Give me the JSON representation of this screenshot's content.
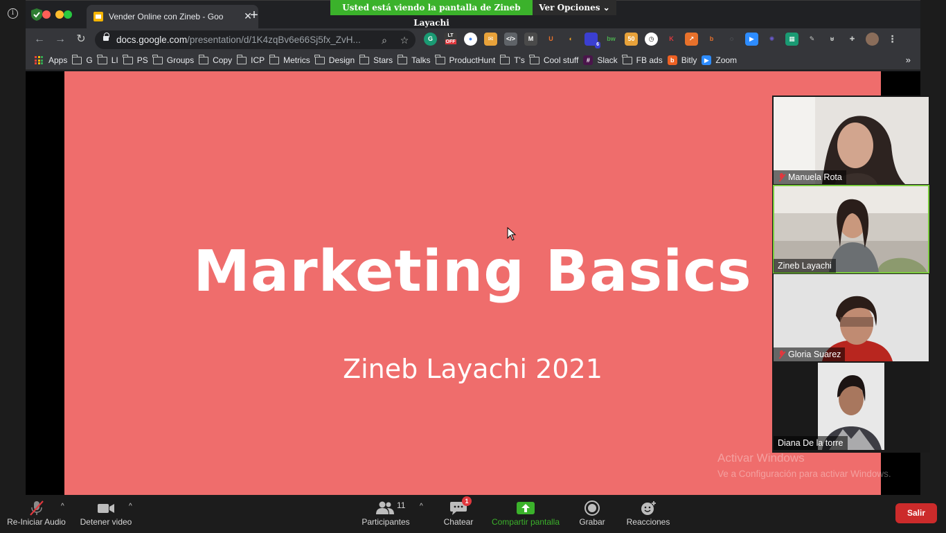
{
  "browser": {
    "tab_title": "Vender Online con Zineb - Goo",
    "url_host": "docs.google.com",
    "url_path": "/presentation/d/1K4zqBv6e66Sj5fx_ZvH...",
    "bookmarks": [
      {
        "label": "Apps",
        "icon": "apps-grid-icon"
      },
      {
        "label": "G",
        "icon": "folder-icon"
      },
      {
        "label": "LI",
        "icon": "folder-icon"
      },
      {
        "label": "PS",
        "icon": "folder-icon"
      },
      {
        "label": "Groups",
        "icon": "folder-icon"
      },
      {
        "label": "Copy",
        "icon": "folder-icon"
      },
      {
        "label": "ICP",
        "icon": "folder-icon"
      },
      {
        "label": "Metrics",
        "icon": "folder-icon"
      },
      {
        "label": "Design",
        "icon": "folder-icon"
      },
      {
        "label": "Stars",
        "icon": "folder-icon"
      },
      {
        "label": "Talks",
        "icon": "folder-icon"
      },
      {
        "label": "ProductHunt",
        "icon": "folder-icon"
      },
      {
        "label": "T's",
        "icon": "folder-icon"
      },
      {
        "label": "Cool stuff",
        "icon": "folder-icon"
      },
      {
        "label": "Slack",
        "icon": "slack-icon"
      },
      {
        "label": "FB ads",
        "icon": "folder-icon"
      },
      {
        "label": "Bitly",
        "icon": "bitly-icon"
      },
      {
        "label": "Zoom",
        "icon": "zoom-icon"
      }
    ],
    "more_bookmarks": "»",
    "extension_badges": {
      "lt": "OFF",
      "count": "6"
    }
  },
  "share": {
    "banner": "Usted está viendo la pantalla de Zineb Layachi",
    "view_options": "Ver Opciones ⌄"
  },
  "slide": {
    "title": "Marketing Basics",
    "subtitle": "Zineb Layachi 2021",
    "background": "#ef6d6c"
  },
  "participants": [
    {
      "name": "Manuela Rota",
      "muted": true
    },
    {
      "name": "Zineb Layachi",
      "muted": false,
      "active": true
    },
    {
      "name": "Gloria Suarez",
      "muted": true
    },
    {
      "name": "Diana De la torre",
      "muted": false
    }
  ],
  "watermark": {
    "title": "Activar Windows",
    "subtitle": "Ve a Configuración para activar Windows."
  },
  "zoombar": {
    "audio": "Re-Iniciar Audio",
    "video": "Detener video",
    "participants": "Participantes",
    "participants_count": "11",
    "chat": "Chatear",
    "chat_badge": "1",
    "share": "Compartir pantalla",
    "record": "Grabar",
    "reactions": "Reacciones",
    "leave": "Salir"
  },
  "colors": {
    "share_green": "#3bb22b",
    "leave_red": "#cc2b2b",
    "active_outline": "#7ccc3e"
  }
}
